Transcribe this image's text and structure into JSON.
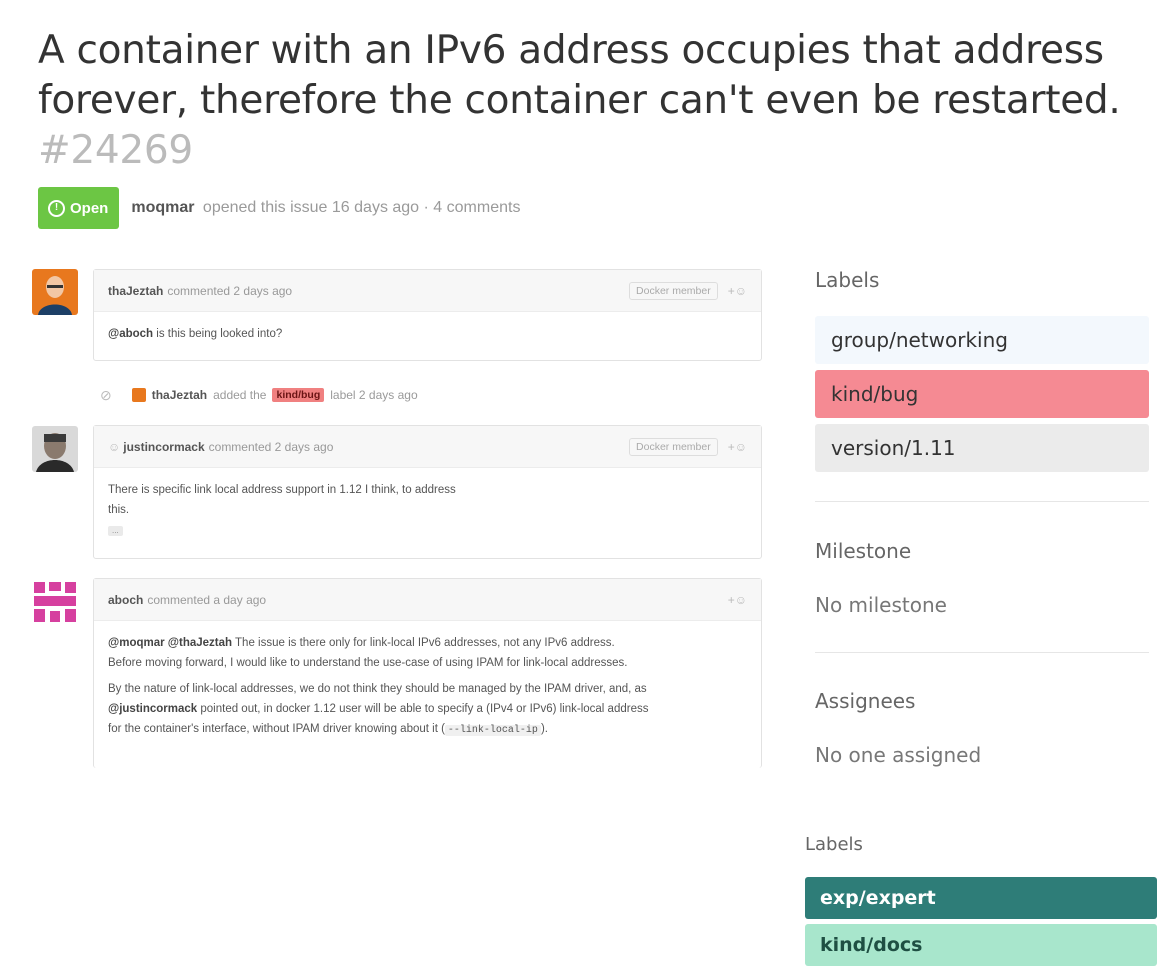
{
  "issue": {
    "title": "A container with an IPv6 address occupies that address forever, therefore the container can't even be restarted.",
    "number": "#24269",
    "state": "Open",
    "author": "moqmar",
    "meta": "opened this issue 16 days ago · 4 comments"
  },
  "comments": [
    {
      "author": "thaJeztah",
      "action": "commented 2 days ago",
      "badge": "Docker member",
      "body_mention": "@aboch",
      "body_text": " is this being looked into?"
    },
    {
      "author": "justincormack",
      "action": "commented 2 days ago",
      "badge": "Docker member",
      "body_line1": "There is specific link local address support in 1.12 I think, to address",
      "body_line2": "this.",
      "more": "..."
    },
    {
      "author": "aboch",
      "action": "commented a day ago",
      "p1_mentions": "@moqmar @thaJeztah",
      "p1_text": " The issue is there only for link-local IPv6 addresses, not any IPv6 address.",
      "p1_text2": "Before moving forward, I would like to understand the use-case of using IPAM for link-local addresses.",
      "p2_text": "By the nature of link-local addresses, we do not think they should be managed by the IPAM driver, and, as",
      "p2_mention": "@justincormack",
      "p2_text2": " pointed out, in docker 1.12 user will be able to specify a (IPv4 or IPv6) link-local address",
      "p2_text3": "for the container's interface, without IPAM driver knowing about it (",
      "p2_code": "--link-local-ip",
      "p2_text4": ")."
    }
  ],
  "event": {
    "author": "thaJeztah",
    "text1": "added the",
    "label": "kind/bug",
    "text2": "label 2 days ago"
  },
  "sidebar": {
    "labels_heading": "Labels",
    "labels": [
      {
        "name": "group/networking",
        "color": "#f3f8fd"
      },
      {
        "name": "kind/bug",
        "color": "#f58a93"
      },
      {
        "name": "version/1.11",
        "color": "#ebebeb"
      }
    ],
    "milestone_heading": "Milestone",
    "milestone_value": "No milestone",
    "assignees_heading": "Assignees",
    "assignees_value": "No one assigned"
  },
  "labels_box2": {
    "heading": "Labels",
    "labels": [
      {
        "name": "exp/expert",
        "color": "#2e7d78",
        "text_color": "#ffffff"
      },
      {
        "name": "kind/docs",
        "color": "#a8e6cc",
        "text_color": "#1f4f43"
      }
    ]
  }
}
